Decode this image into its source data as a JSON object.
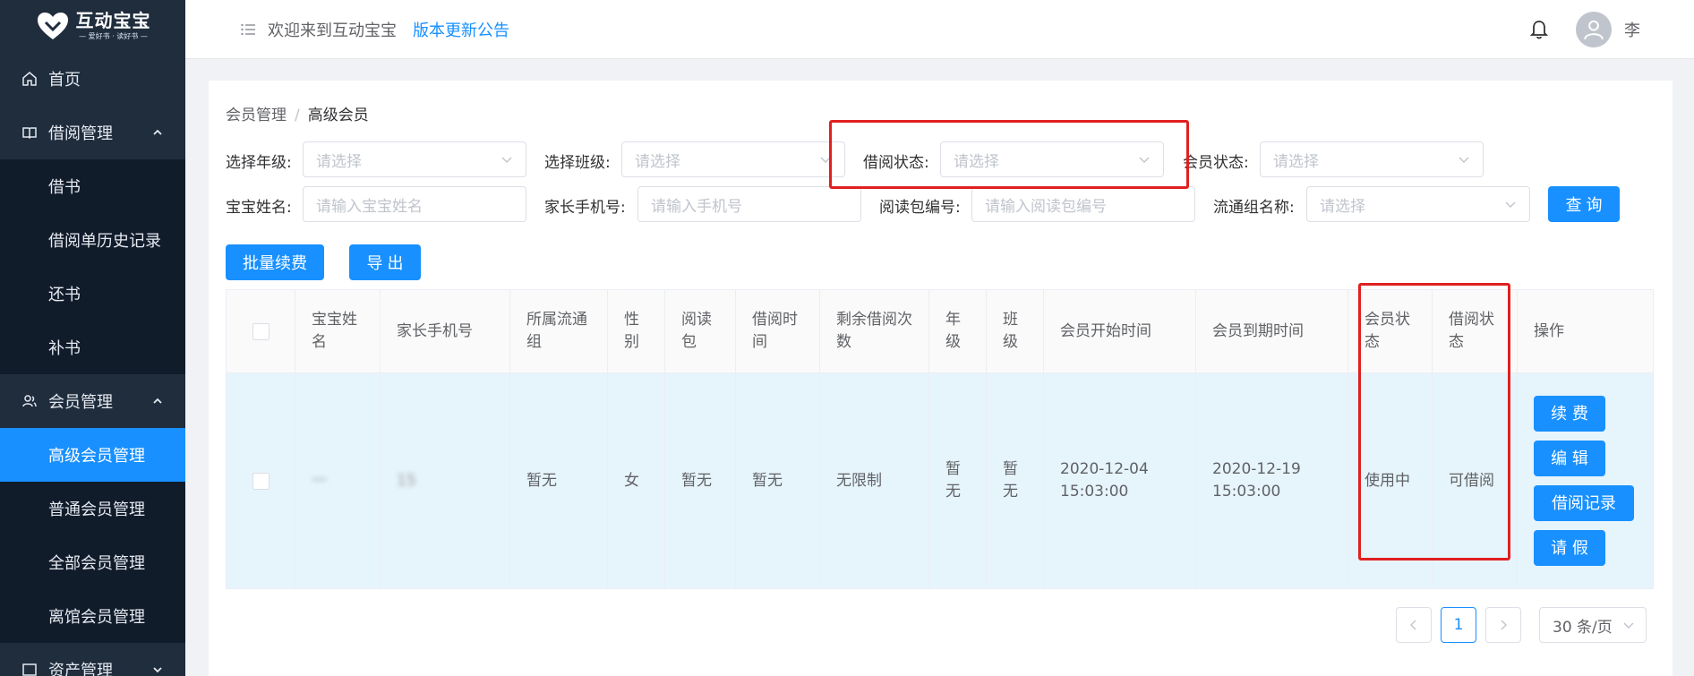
{
  "logo": {
    "title": "互动宝宝",
    "subtitle": "— 爱好书 · 读好书 —"
  },
  "sidebar": {
    "home": "首页",
    "borrow_group": {
      "label": "借阅管理",
      "items": [
        "借书",
        "借阅单历史记录",
        "还书",
        "补书"
      ]
    },
    "member_group": {
      "label": "会员管理",
      "items": [
        "高级会员管理",
        "普通会员管理",
        "全部会员管理",
        "离馆会员管理"
      ]
    },
    "next_group": "资产管理"
  },
  "header": {
    "welcome": "欢迎来到互动宝宝",
    "announcement": "版本更新公告",
    "user": "李"
  },
  "breadcrumb": {
    "parent": "会员管理",
    "current": "高级会员"
  },
  "filters": {
    "grade_label": "选择年级:",
    "grade_placeholder": "请选择",
    "class_label": "选择班级:",
    "class_placeholder": "请选择",
    "borrow_status_label": "借阅状态:",
    "borrow_status_placeholder": "请选择",
    "member_status_label": "会员状态:",
    "member_status_placeholder": "请选择",
    "baby_name_label": "宝宝姓名:",
    "baby_name_placeholder": "请输入宝宝姓名",
    "phone_label": "家长手机号:",
    "phone_placeholder": "请输入手机号",
    "package_label": "阅读包编号:",
    "package_placeholder": "请输入阅读包编号",
    "circulation_label": "流通组名称:",
    "circulation_placeholder": "请选择",
    "query_button": "查 询"
  },
  "actions": {
    "batch_renew": "批量续费",
    "export": "导 出"
  },
  "table": {
    "headers": [
      "宝宝姓名",
      "家长手机号",
      "所属流通组",
      "性别",
      "阅读包",
      "借阅时间",
      "剩余借阅次数",
      "年级",
      "班级",
      "会员开始时间",
      "会员到期时间",
      "会员状态",
      "借阅状态",
      "操作"
    ],
    "row": {
      "name": "一",
      "phone": "15",
      "circulation": "暂无",
      "gender": "女",
      "package": "暂无",
      "borrow_time": "暂无",
      "remaining": "无限制",
      "grade": "暂无",
      "class": "暂无",
      "start_time": "2020-12-04 15:03:00",
      "end_time": "2020-12-19 15:03:00",
      "member_status": "使用中",
      "borrow_status": "可借阅",
      "ops": [
        "续 费",
        "编 辑",
        "借阅记录",
        "请 假"
      ]
    }
  },
  "pagination": {
    "page": "1",
    "page_size": "30 条/页"
  },
  "colors": {
    "primary": "#1890ff",
    "sidebar": "#1f2d3d",
    "highlight": "#e02020"
  }
}
